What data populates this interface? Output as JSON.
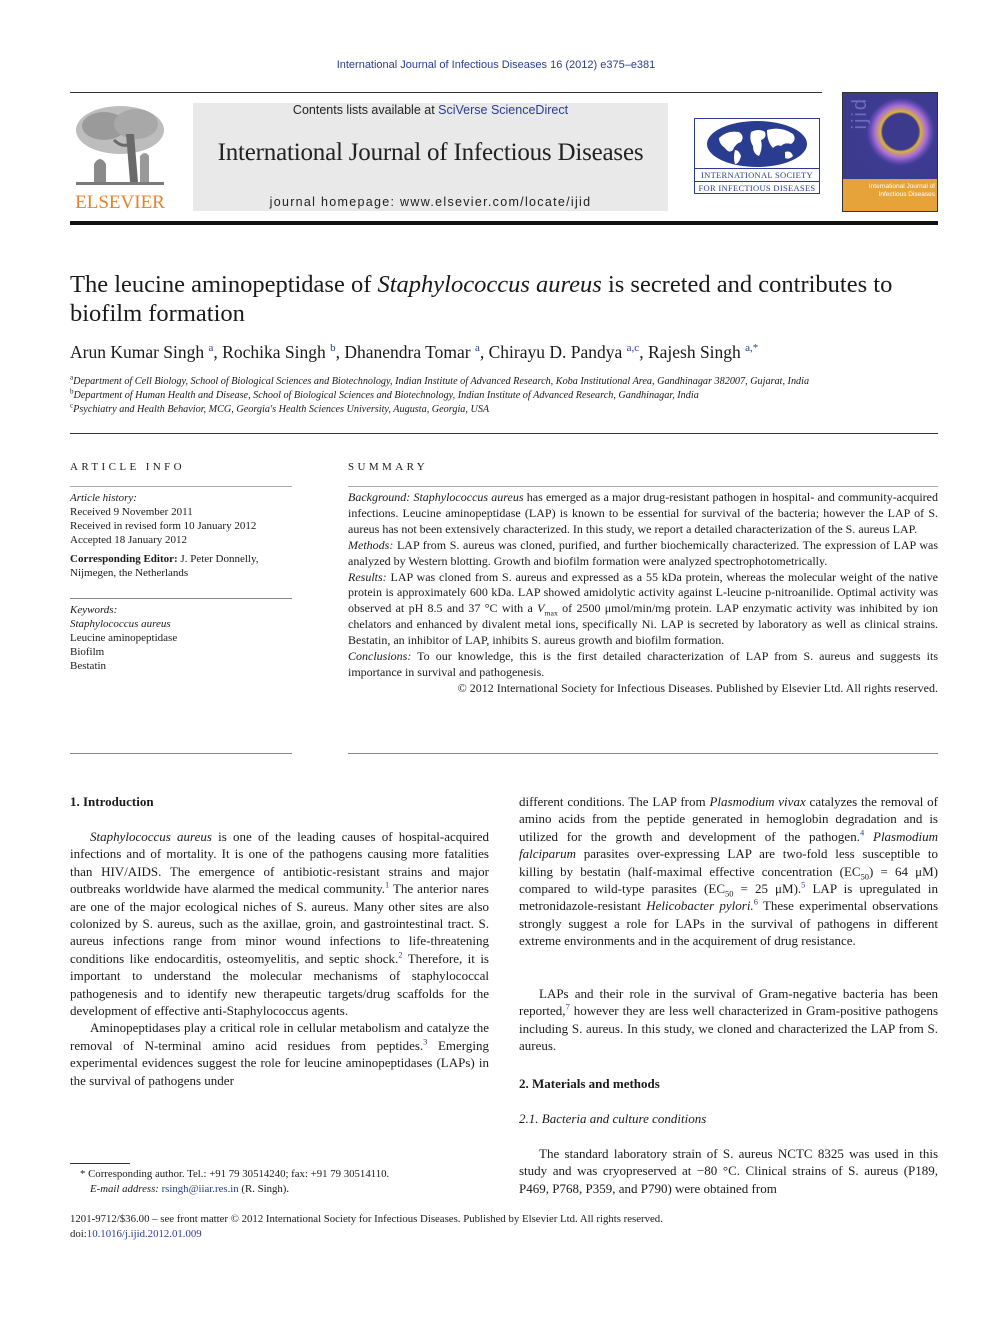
{
  "running_header": "International Journal of Infectious Diseases 16 (2012) e375–e381",
  "masthead": {
    "publisher_wordmark": "ELSEVIER",
    "contents_prefix": "Contents lists available at ",
    "contents_link": "SciVerse ScienceDirect",
    "journal_title": "International Journal of Infectious Diseases",
    "homepage_prefix": "journal homepage: ",
    "homepage_url": "www.elsevier.com/locate/ijid",
    "society_logo_line1": "INTERNATIONAL SOCIETY",
    "society_logo_line2": "FOR INFECTIOUS DISEASES",
    "cover_letters": "ijid",
    "cover_title": "International Journal of Infectious Diseases",
    "colors": {
      "elsevier_orange": "#e8812a",
      "link_blue": "#2a3c8f",
      "masthead_gray": "#e9e9e9",
      "cover_purple": "#3b3a8c",
      "cover_band": "#e6a33a"
    }
  },
  "article": {
    "title_part1": "The leucine aminopeptidase of ",
    "title_italic": "Staphylococcus aureus",
    "title_part2": " is secreted and contributes to biofilm formation",
    "authors": [
      {
        "name": "Arun Kumar Singh",
        "sup": "a"
      },
      {
        "name": "Rochika Singh",
        "sup": "b"
      },
      {
        "name": "Dhanendra Tomar",
        "sup": "a"
      },
      {
        "name": "Chirayu D. Pandya",
        "sup": "a,c"
      },
      {
        "name": "Rajesh Singh",
        "sup": "a,*"
      }
    ],
    "affiliations": [
      {
        "key": "a",
        "text": "Department of Cell Biology, School of Biological Sciences and Biotechnology, Indian Institute of Advanced Research, Koba Institutional Area, Gandhinagar 382007, Gujarat, India"
      },
      {
        "key": "b",
        "text": "Department of Human Health and Disease, School of Biological Sciences and Biotechnology, Indian Institute of Advanced Research, Gandhinagar, India"
      },
      {
        "key": "c",
        "text": "Psychiatry and Health Behavior, MCG, Georgia's Health Sciences University, Augusta, Georgia, USA"
      }
    ]
  },
  "article_info": {
    "heading": "ARTICLE INFO",
    "history_label": "Article history:",
    "received": "Received 9 November 2011",
    "revised": "Received in revised form 10 January 2012",
    "accepted": "Accepted 18 January 2012",
    "editor_label": "Corresponding Editor:",
    "editor_value": " J. Peter Donnelly, Nijmegen, the Netherlands",
    "keywords_label": "Keywords:",
    "keywords": [
      "Staphylococcus aureus",
      "Leucine aminopeptidase",
      "Biofilm",
      "Bestatin"
    ]
  },
  "summary": {
    "heading": "SUMMARY",
    "background_label": "Background:",
    "background_italic": "Staphylococcus aureus",
    "background_text": " has emerged as a major drug-resistant pathogen in hospital- and community-acquired infections. Leucine aminopeptidase (LAP) is known to be essential for survival of the bacteria; however the LAP of S. aureus has not been extensively characterized. In this study, we report a detailed characterization of the S. aureus LAP.",
    "methods_label": "Methods:",
    "methods_text": " LAP from S. aureus was cloned, purified, and further biochemically characterized. The expression of LAP was analyzed by Western blotting. Growth and biofilm formation were analyzed spectrophotometrically.",
    "results_label": "Results:",
    "results_text_1": "  LAP was cloned from S. aureus and expressed as a 55 kDa protein, whereas the molecular weight of the native protein is approximately 600 kDa. LAP showed amidolytic activity against L-leucine p-nitroanilide. Optimal activity was observed at pH 8.5 and 37 °C with a ",
    "results_vmax": "V",
    "results_vmax_sub": "max",
    "results_text_2": " of 2500 μmol/min/mg protein. LAP enzymatic activity was inhibited by ion chelators and enhanced by divalent metal ions, specifically Ni. LAP is secreted by laboratory as well as clinical strains. Bestatin, an inhibitor of LAP, inhibits S. aureus growth and biofilm formation.",
    "conclusions_label": "Conclusions:",
    "conclusions_text": " To our knowledge, this is the first detailed characterization of LAP from S. aureus and suggests its importance in survival and pathogenesis.",
    "copyright": "© 2012 International Society for Infectious Diseases. Published by Elsevier Ltd. All rights reserved."
  },
  "body": {
    "intro_heading": "1.  Introduction",
    "intro_p1_italic": "Staphylococcus aureus",
    "intro_p1_a": " is one of the leading causes of hospital-acquired infections and of mortality. It is one of the pathogens causing more fatalities than HIV/AIDS. The emergence of antibiotic-resistant strains and major outbreaks worldwide have alarmed the medical community.",
    "ref1": "1",
    "intro_p1_b": " The anterior nares are one of the major ecological niches of S. aureus. Many other sites are also colonized by S. aureus, such as the axillae, groin, and gastrointestinal tract. S. aureus infections range from minor wound infections to life-threatening conditions like endocarditis, osteomyelitis, and septic shock.",
    "ref2": "2",
    "intro_p1_c": " Therefore, it is important to understand the molecular mechanisms of staphylococcal pathogenesis and to identify new therapeutic targets/drug scaffolds for the development of effective anti-Staphylococcus agents.",
    "intro_p2_a": "Aminopeptidases play a critical role in cellular metabolism and catalyze the removal of N-terminal amino acid residues from peptides.",
    "ref3": "3",
    "intro_p2_b": " Emerging experimental evidences suggest the role for leucine aminopeptidases (LAPs) in the survival of pathogens under",
    "right_p1_a": "different conditions. The LAP from ",
    "right_p1_it1": "Plasmodium vivax",
    "right_p1_b": " catalyzes the removal of amino acids from the peptide generated in hemoglobin degradation and is utilized for the growth and development of the pathogen.",
    "ref4": "4",
    "right_p1_it2": " Plasmodium falciparum",
    "right_p1_c": " parasites over-expressing LAP are two-fold less susceptible to killing by bestatin (half-maximal effective concentration (EC",
    "ec_sub": "50",
    "right_p1_d": ") = 64 μM) compared to wild-type parasites (EC",
    "right_p1_e": " = 25 μM).",
    "ref5": "5",
    "right_p1_f": " LAP is upregulated in metronidazole-resistant ",
    "right_p1_it3": "Helicobacter pylori.",
    "ref6": "6",
    "right_p1_g": " These experimental observations strongly suggest a role for LAPs in the survival of pathogens in different extreme environments and in the acquirement of drug resistance.",
    "right_p2_a": "LAPs and their role in the survival of Gram-negative bacteria has been reported,",
    "ref7": "7",
    "right_p2_b": " however they are less well characterized in Gram-positive pathogens including S. aureus. In this study, we cloned and characterized the LAP from S. aureus.",
    "methods_heading": "2.  Materials and methods",
    "subsection_heading": "2.1.  Bacteria and culture conditions",
    "right_p3": "The standard laboratory strain of S. aureus NCTC 8325 was used in this study and was cryopreserved at −80 °C. Clinical strains of S. aureus (P189, P469, P768, P359, and P790) were obtained from"
  },
  "footnote": {
    "marker": "*",
    "corresponding": " Corresponding author. Tel.: +91 79 30514240; fax: +91 79 30514110.",
    "email_label": "E-mail address:",
    "email": "rsingh@iiar.res.in",
    "email_suffix": " (R. Singh)."
  },
  "front_matter": {
    "issn_line": "1201-9712/$36.00 – see front matter © 2012 International Society for Infectious Diseases. Published by Elsevier Ltd. All rights reserved.",
    "doi_prefix": "doi:",
    "doi": "10.1016/j.ijid.2012.01.009"
  }
}
